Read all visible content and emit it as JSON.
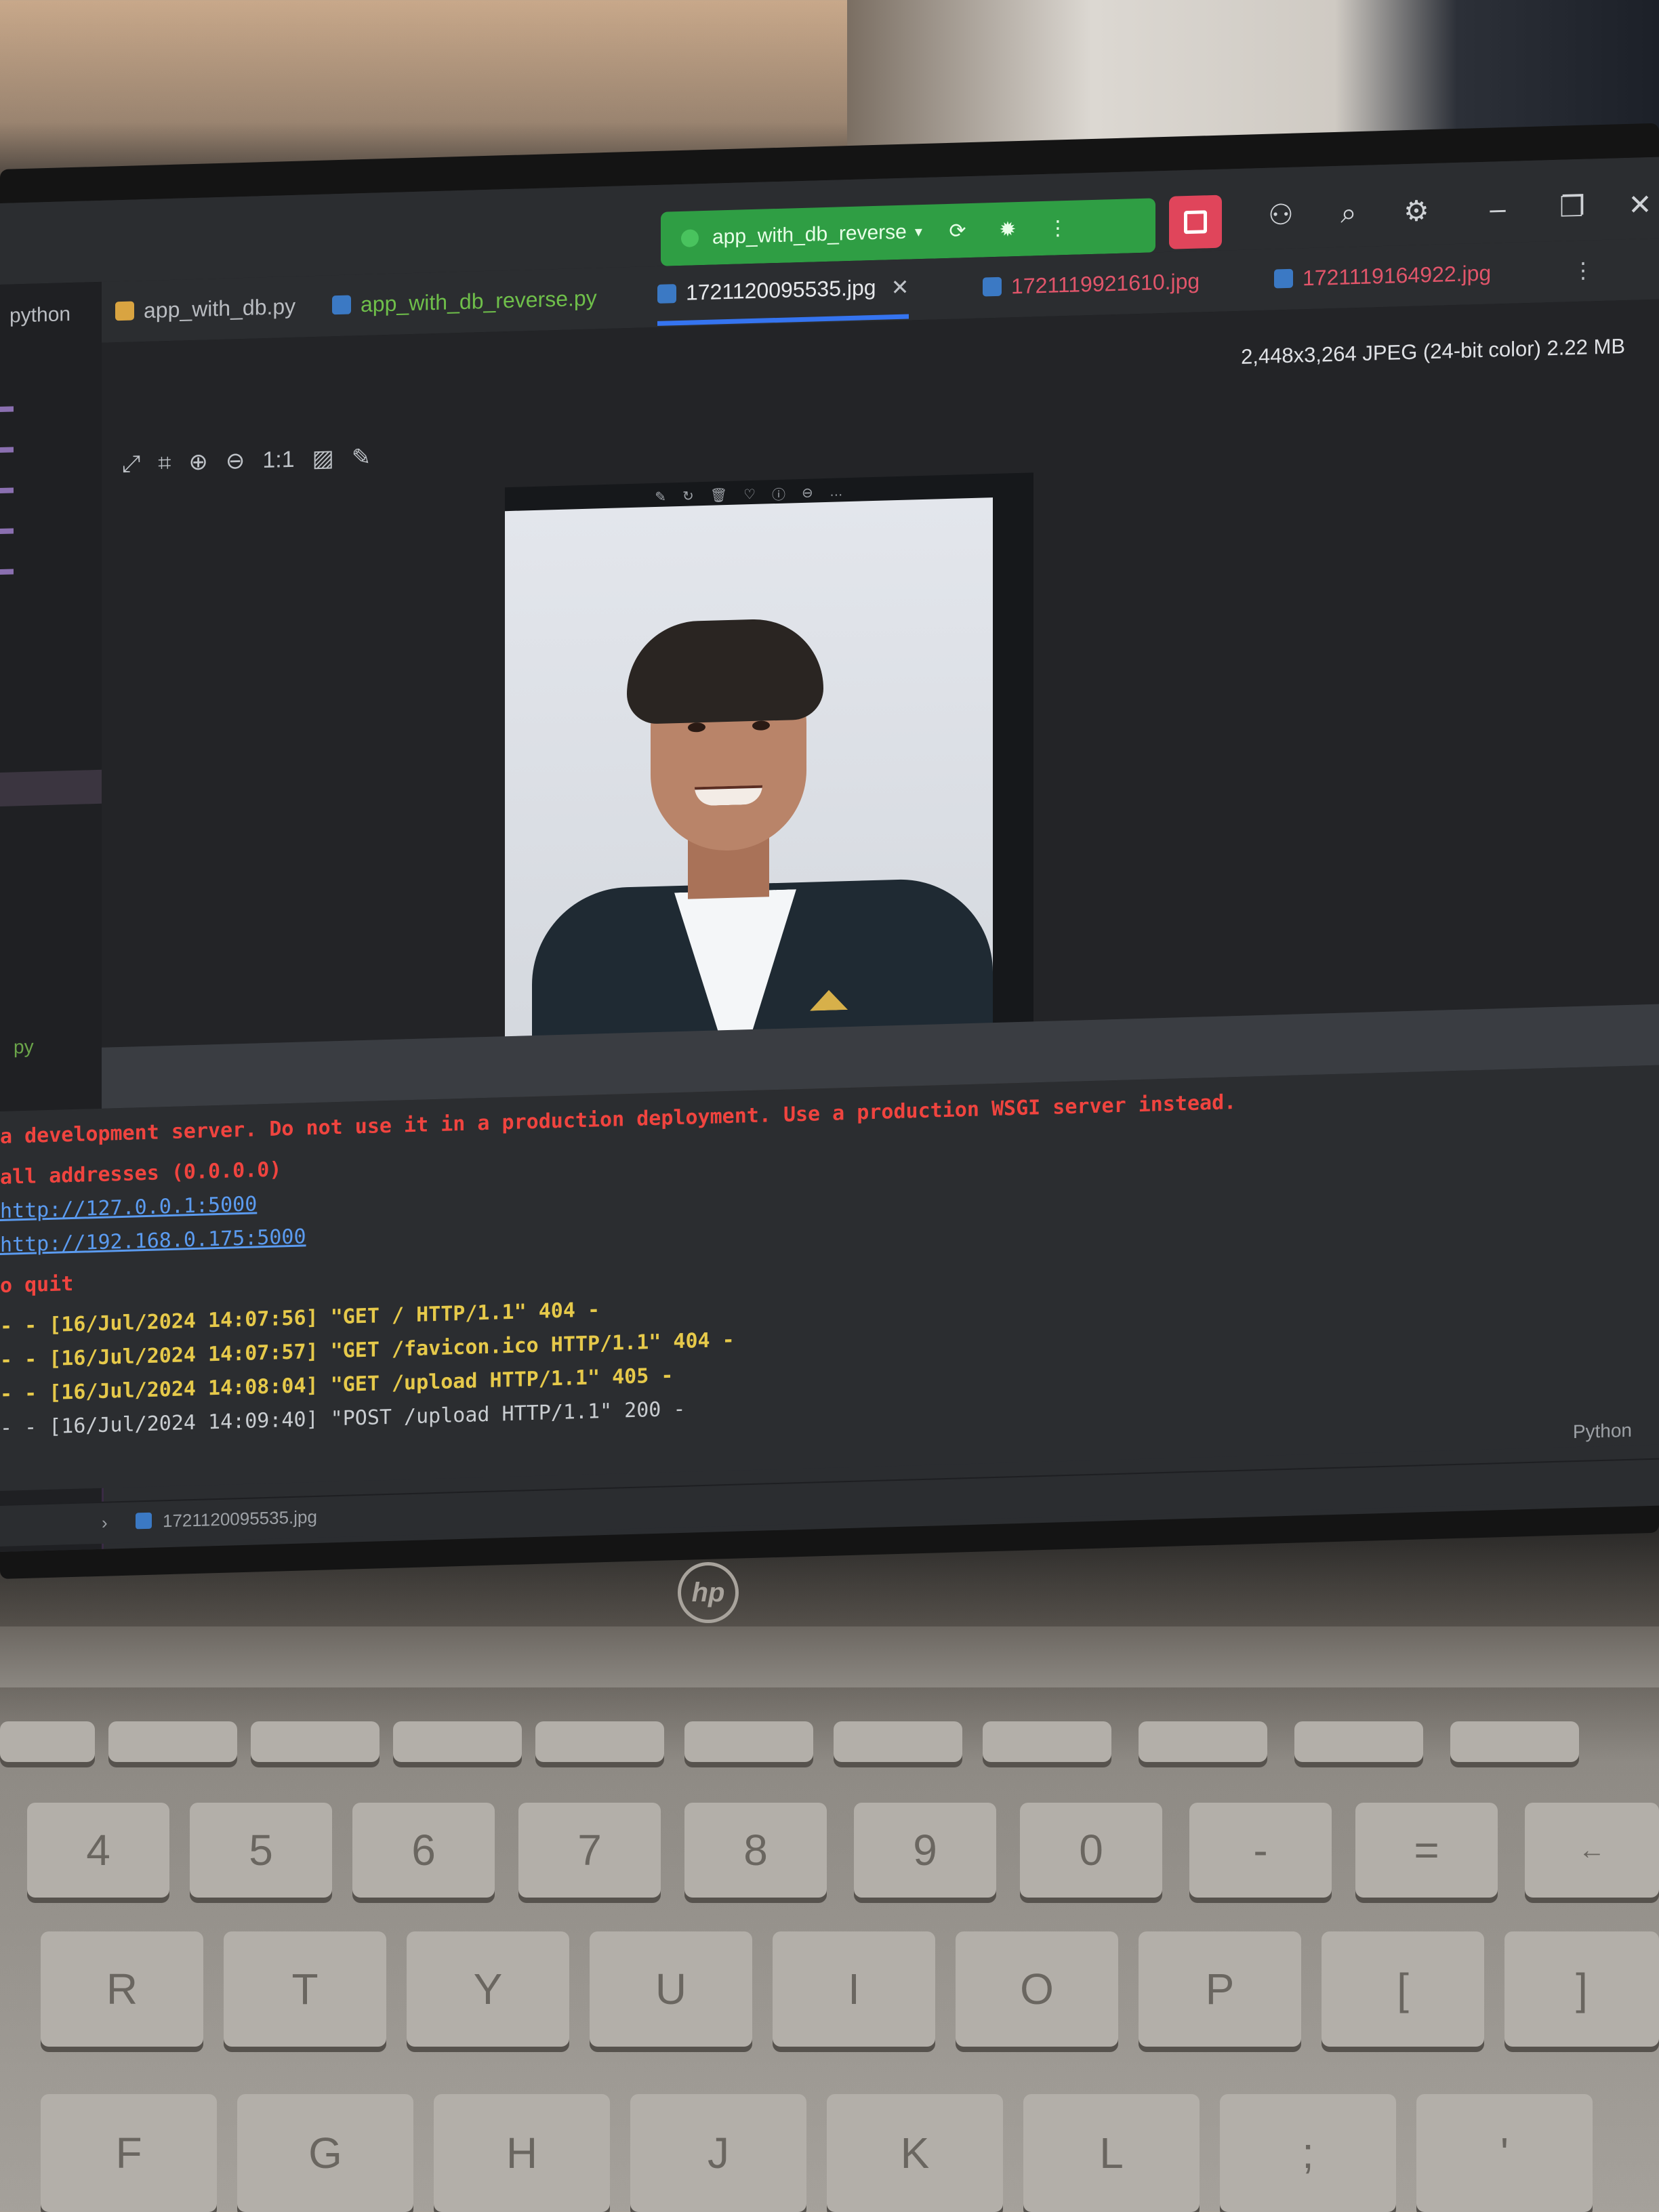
{
  "toolbar": {
    "run_config": "app_with_db_reverse",
    "rerun_icon": "rerun-icon",
    "debug_icon": "debug-icon",
    "more": "⋮"
  },
  "sidebar": {
    "project_label": "python",
    "py_label": "py"
  },
  "tabs": [
    {
      "label": "app_with_db.py",
      "color": "#b9bcc1"
    },
    {
      "label": "app_with_db_reverse.py",
      "color": "#6fbf4a"
    },
    {
      "label": "1721120095535.jpg",
      "color": "#e6e8eb"
    },
    {
      "label": "1721119921610.jpg",
      "color": "#e0556a"
    },
    {
      "label": "1721119164922.jpg",
      "color": "#e0556a"
    }
  ],
  "image_info": "2,448x3,264 JPEG (24-bit color) 2.22 MB",
  "viewer_tools": {
    "actual_size": "1:1"
  },
  "terminal": {
    "warning": "a development server. Do not use it in a production deployment. Use a production WSGI server instead.",
    "all_addresses": "all addresses (0.0.0.0)",
    "link1": "http://127.0.0.1:5000",
    "link2": "http://192.168.0.175:5000",
    "quit": "o quit",
    "log1": "- - [16/Jul/2024 14:07:56] \"GET / HTTP/1.1\" 404 -",
    "log2": "- - [16/Jul/2024 14:07:57] \"GET /favicon.ico HTTP/1.1\" 404 -",
    "log3": "- - [16/Jul/2024 14:08:04] \"GET /upload HTTP/1.1\" 405 -",
    "log4": "- - [16/Jul/2024 14:09:40] \"POST /upload HTTP/1.1\" 200 -"
  },
  "status": {
    "breadcrumb": "1721120095535.jpg",
    "interpreter": "Python"
  },
  "keyboard": {
    "row_numbers": [
      "4",
      "5",
      "6",
      "7",
      "8",
      "9",
      "0",
      "-",
      "="
    ],
    "row_numbers_shift": [
      "$",
      "%",
      "^",
      "&",
      "*",
      "(",
      ")",
      "_",
      "+"
    ],
    "row_letters1": [
      "R",
      "T",
      "Y",
      "U",
      "I",
      "O",
      "P",
      "[",
      "]"
    ],
    "row_letters2": [
      "F",
      "G",
      "H",
      "J",
      "K",
      "L",
      ";",
      "'"
    ],
    "brand": "hp"
  },
  "colors": {
    "accent": "#3574f0",
    "run_green": "#2f9e44",
    "stop_red": "#e0455b",
    "error_red": "#f0443f"
  }
}
